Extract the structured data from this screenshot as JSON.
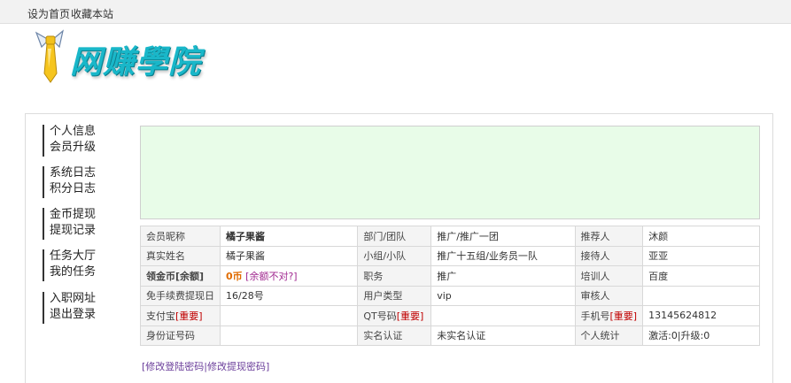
{
  "topbar": {
    "set_home": "设为首页",
    "bookmark": "收藏本站"
  },
  "logo": {
    "text": "网赚學院",
    "icon": "necktie-icon"
  },
  "menu": {
    "items": [
      {
        "label": "个人信息"
      },
      {
        "label": "会员升级"
      },
      {
        "label": "系统日志"
      },
      {
        "label": "积分日志"
      },
      {
        "label": "金币提现"
      },
      {
        "label": "提现记录"
      },
      {
        "label": "任务大厅"
      },
      {
        "label": "我的任务"
      },
      {
        "label": "入职网址"
      },
      {
        "label": "退出登录"
      }
    ]
  },
  "info": {
    "r1": {
      "l1": "会员昵称",
      "v1": "橘子果酱",
      "l2": "部门/团队",
      "v2": "推广/推广一团",
      "l3": "推荐人",
      "v3": "沐颜"
    },
    "r2": {
      "l1": "真实姓名",
      "v1": "橘子果酱",
      "l2": "小组/小队",
      "v2": "推广十五组/业务员一队",
      "l3": "接待人",
      "v3": "亚亚"
    },
    "r3": {
      "l1": "领金币[余额]",
      "v1": "0币",
      "v1b": "[余额不对?]",
      "l2": "职务",
      "v2": "推广",
      "l3": "培训人",
      "v3": "百度"
    },
    "r4": {
      "l1": "免手续费提现日",
      "v1": "16/28号",
      "l2": "用户类型",
      "v2": "vip",
      "l3": "审核人",
      "v3": ""
    },
    "r5": {
      "l1": "支付宝",
      "l1b": "[重要]",
      "v1": "",
      "l2": "QT号码",
      "l2b": "[重要]",
      "v2": "",
      "l3": "手机号",
      "l3b": "[重要]",
      "v3": "13145624812"
    },
    "r6": {
      "l1": "身份证号码",
      "v1": "",
      "l2": "实名认证",
      "v2": "未实名认证",
      "l3": "个人统计",
      "v3": "激活:0|升级:0"
    }
  },
  "links": {
    "change_login": "[修改登陆密码",
    "sep": "|",
    "change_withdraw": "修改提现密码]"
  }
}
